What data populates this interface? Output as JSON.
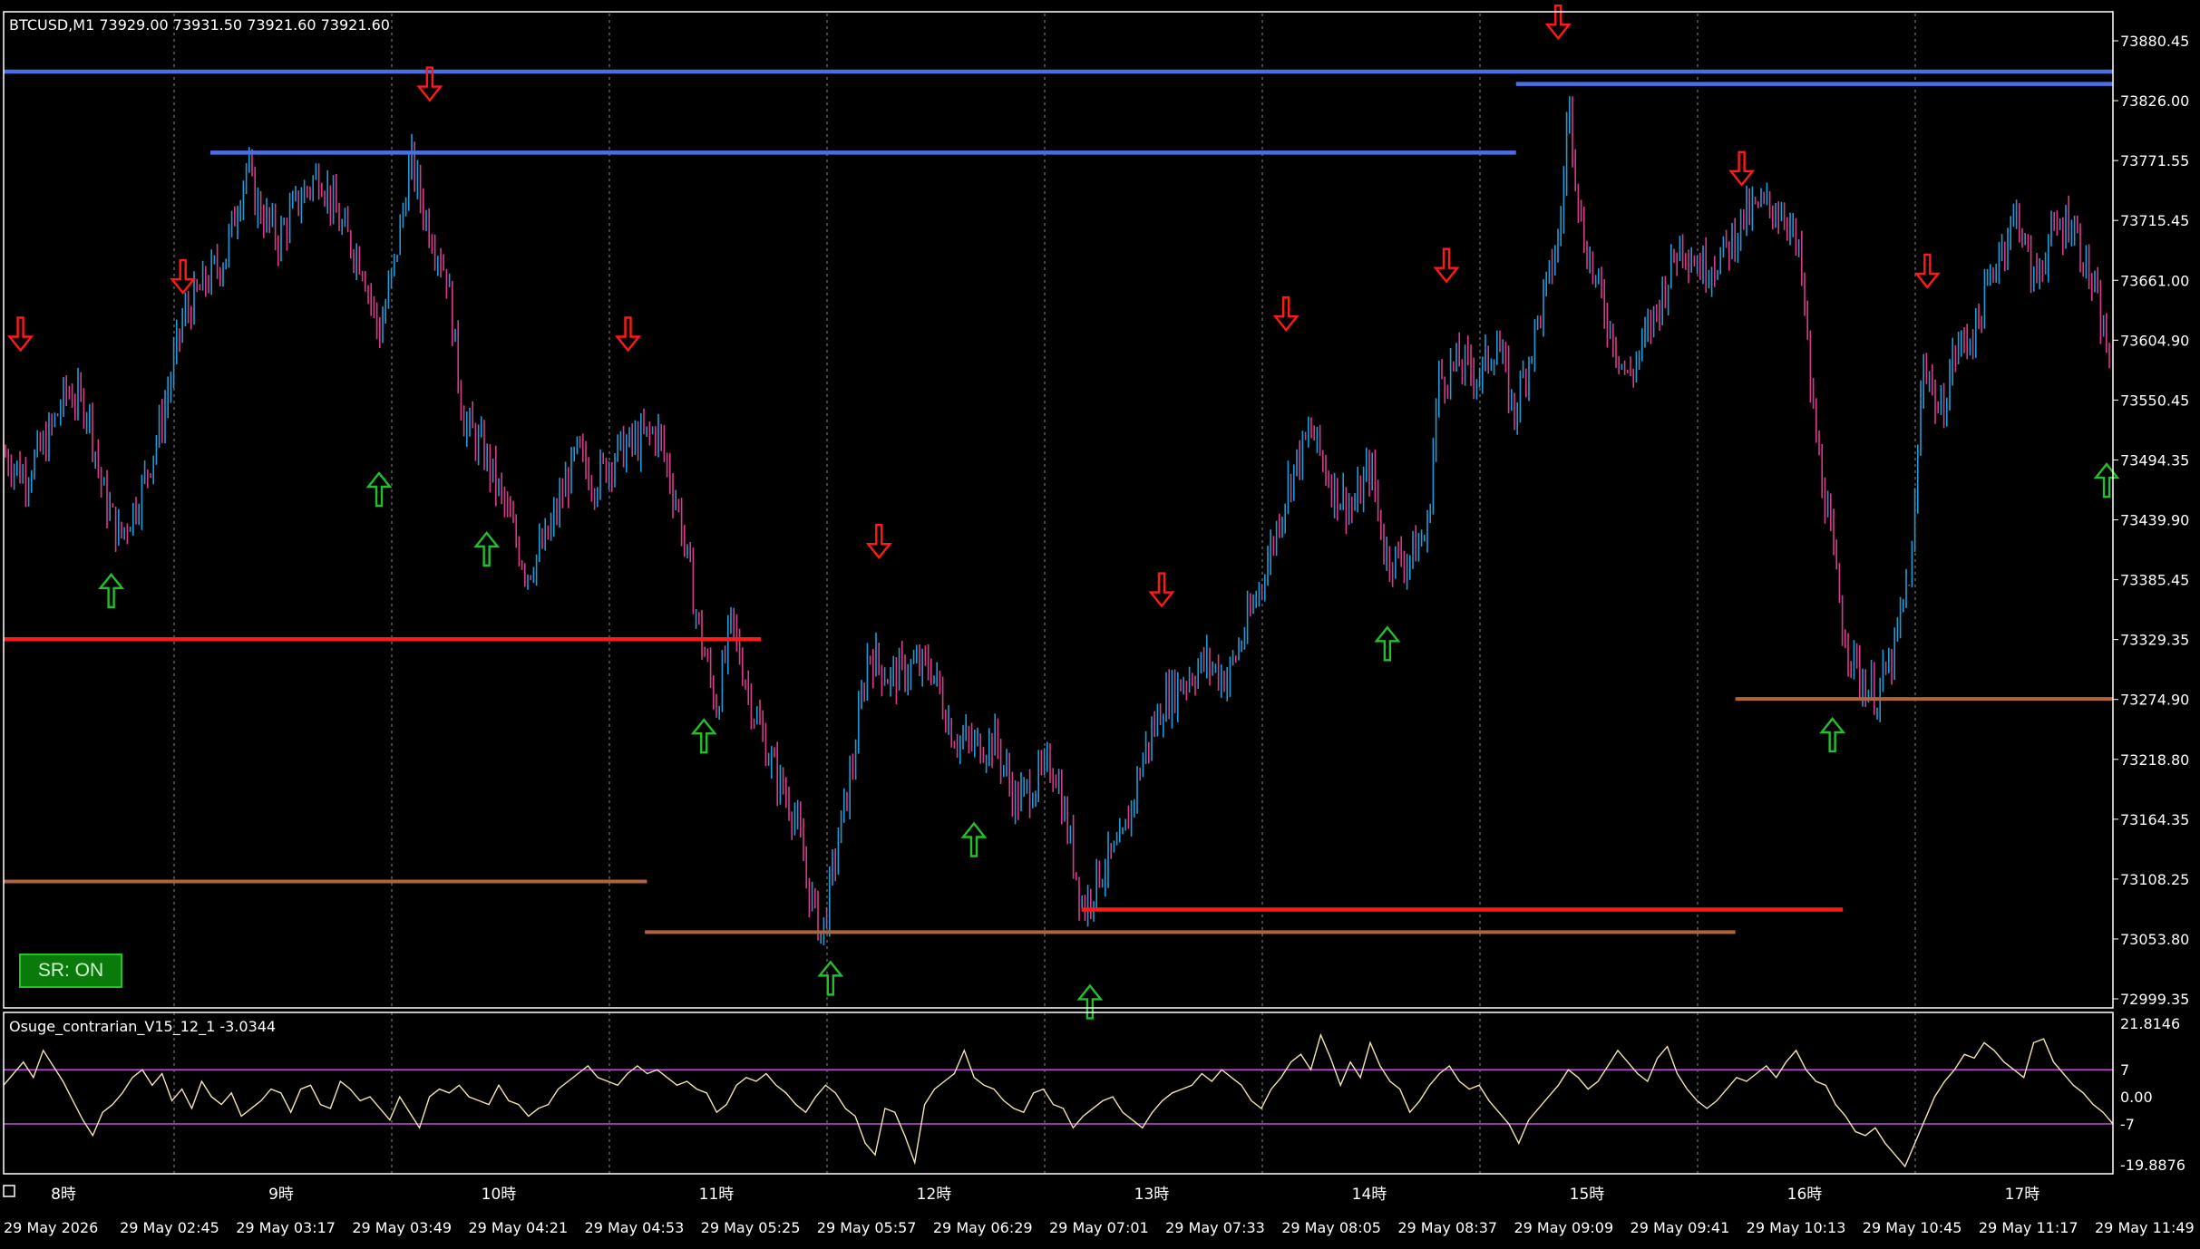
{
  "header": {
    "symbol_info": "BTCUSD,M1  73929.00 73931.50 73921.60 73921.60",
    "indicator_info": "Osuge_contrarian_V15_12_1 -3.0344"
  },
  "sr_button": {
    "label": "SR: ON"
  },
  "colors": {
    "background": "#000000",
    "bull_candle": "#1e9bd7",
    "bear_candle": "#d83a8c",
    "resistance_line": "#4a6fe3",
    "support_red": "#ff1a1a",
    "support_brown": "#b0643a",
    "signal_down": "#ff1a1a",
    "signal_up": "#22c02a",
    "oscillator": "#f3e3b0",
    "oscillator_levels": "#c24fd8",
    "grid": "#8a8a8a"
  },
  "chart_data": [
    {
      "type": "candlestick",
      "title": "BTCUSD,M1",
      "y_ticks": [
        "73880.45",
        "73826.00",
        "73771.55",
        "73715.45",
        "73661.00",
        "73604.90",
        "73550.45",
        "73494.35",
        "73439.90",
        "73385.45",
        "73329.35",
        "73274.90",
        "73218.80",
        "73164.35",
        "73108.25",
        "73053.80",
        "72999.35"
      ],
      "ylim": [
        72999.35,
        73880.45
      ],
      "x_ticks_hour": [
        "8時",
        "9時",
        "10時",
        "11時",
        "12時",
        "13時",
        "14時",
        "15時",
        "16時",
        "17時"
      ],
      "x_ticks_time": [
        "29 May 2026",
        "29 May 02:45",
        "29 May 03:17",
        "29 May 03:49",
        "29 May 04:21",
        "29 May 04:53",
        "29 May 05:25",
        "29 May 05:57",
        "29 May 06:29",
        "29 May 07:01",
        "29 May 07:33",
        "29 May 08:05",
        "29 May 08:37",
        "29 May 09:09",
        "29 May 09:41",
        "29 May 10:13",
        "29 May 10:45",
        "29 May 11:17",
        "29 May 11:49"
      ],
      "grid": "vertical dotted at hour marks",
      "price_path": [
        {
          "x": 0.0,
          "y": 73490
        },
        {
          "x": 0.01,
          "y": 73470
        },
        {
          "x": 0.02,
          "y": 73500
        },
        {
          "x": 0.03,
          "y": 73545
        },
        {
          "x": 0.04,
          "y": 73530
        },
        {
          "x": 0.047,
          "y": 73455
        },
        {
          "x": 0.055,
          "y": 73415
        },
        {
          "x": 0.065,
          "y": 73455
        },
        {
          "x": 0.075,
          "y": 73520
        },
        {
          "x": 0.085,
          "y": 73610
        },
        {
          "x": 0.095,
          "y": 73640
        },
        {
          "x": 0.105,
          "y": 73665
        },
        {
          "x": 0.115,
          "y": 73745
        },
        {
          "x": 0.12,
          "y": 73712
        },
        {
          "x": 0.13,
          "y": 73680
        },
        {
          "x": 0.14,
          "y": 73715
        },
        {
          "x": 0.15,
          "y": 73740
        },
        {
          "x": 0.16,
          "y": 73690
        },
        {
          "x": 0.17,
          "y": 73660
        },
        {
          "x": 0.178,
          "y": 73595
        },
        {
          "x": 0.185,
          "y": 73655
        },
        {
          "x": 0.193,
          "y": 73750
        },
        {
          "x": 0.2,
          "y": 73700
        },
        {
          "x": 0.21,
          "y": 73650
        },
        {
          "x": 0.218,
          "y": 73520
        },
        {
          "x": 0.228,
          "y": 73490
        },
        {
          "x": 0.238,
          "y": 73440
        },
        {
          "x": 0.248,
          "y": 73385
        },
        {
          "x": 0.258,
          "y": 73415
        },
        {
          "x": 0.265,
          "y": 73455
        },
        {
          "x": 0.272,
          "y": 73490
        },
        {
          "x": 0.28,
          "y": 73465
        },
        {
          "x": 0.29,
          "y": 73490
        },
        {
          "x": 0.3,
          "y": 73500
        },
        {
          "x": 0.31,
          "y": 73510
        },
        {
          "x": 0.32,
          "y": 73440
        },
        {
          "x": 0.33,
          "y": 73330
        },
        {
          "x": 0.338,
          "y": 73265
        },
        {
          "x": 0.345,
          "y": 73340
        },
        {
          "x": 0.355,
          "y": 73265
        },
        {
          "x": 0.365,
          "y": 73210
        },
        {
          "x": 0.375,
          "y": 73170
        },
        {
          "x": 0.382,
          "y": 73100
        },
        {
          "x": 0.388,
          "y": 73062
        },
        {
          "x": 0.395,
          "y": 73140
        },
        {
          "x": 0.403,
          "y": 73220
        },
        {
          "x": 0.41,
          "y": 73315
        },
        {
          "x": 0.42,
          "y": 73290
        },
        {
          "x": 0.43,
          "y": 73300
        },
        {
          "x": 0.44,
          "y": 73300
        },
        {
          "x": 0.45,
          "y": 73240
        },
        {
          "x": 0.46,
          "y": 73230
        },
        {
          "x": 0.47,
          "y": 73235
        },
        {
          "x": 0.48,
          "y": 73180
        },
        {
          "x": 0.49,
          "y": 73200
        },
        {
          "x": 0.498,
          "y": 73215
        },
        {
          "x": 0.505,
          "y": 73150
        },
        {
          "x": 0.512,
          "y": 73085
        },
        {
          "x": 0.52,
          "y": 73120
        },
        {
          "x": 0.53,
          "y": 73140
        },
        {
          "x": 0.54,
          "y": 73220
        },
        {
          "x": 0.55,
          "y": 73270
        },
        {
          "x": 0.56,
          "y": 73290
        },
        {
          "x": 0.57,
          "y": 73305
        },
        {
          "x": 0.58,
          "y": 73290
        },
        {
          "x": 0.59,
          "y": 73340
        },
        {
          "x": 0.6,
          "y": 73400
        },
        {
          "x": 0.61,
          "y": 73470
        },
        {
          "x": 0.62,
          "y": 73510
        },
        {
          "x": 0.63,
          "y": 73460
        },
        {
          "x": 0.64,
          "y": 73440
        },
        {
          "x": 0.648,
          "y": 73480
        },
        {
          "x": 0.655,
          "y": 73400
        },
        {
          "x": 0.665,
          "y": 73395
        },
        {
          "x": 0.675,
          "y": 73420
        },
        {
          "x": 0.68,
          "y": 73555
        },
        {
          "x": 0.69,
          "y": 73570
        },
        {
          "x": 0.7,
          "y": 73560
        },
        {
          "x": 0.708,
          "y": 73590
        },
        {
          "x": 0.716,
          "y": 73525
        },
        {
          "x": 0.725,
          "y": 73590
        },
        {
          "x": 0.732,
          "y": 73640
        },
        {
          "x": 0.738,
          "y": 73690
        },
        {
          "x": 0.742,
          "y": 73805
        },
        {
          "x": 0.748,
          "y": 73690
        },
        {
          "x": 0.755,
          "y": 73640
        },
        {
          "x": 0.762,
          "y": 73600
        },
        {
          "x": 0.77,
          "y": 73555
        },
        {
          "x": 0.778,
          "y": 73590
        },
        {
          "x": 0.786,
          "y": 73630
        },
        {
          "x": 0.795,
          "y": 73680
        },
        {
          "x": 0.805,
          "y": 73655
        },
        {
          "x": 0.815,
          "y": 73665
        },
        {
          "x": 0.825,
          "y": 73700
        },
        {
          "x": 0.835,
          "y": 73710
        },
        {
          "x": 0.845,
          "y": 73705
        },
        {
          "x": 0.852,
          "y": 73655
        },
        {
          "x": 0.858,
          "y": 73520
        },
        {
          "x": 0.865,
          "y": 73430
        },
        {
          "x": 0.872,
          "y": 73335
        },
        {
          "x": 0.88,
          "y": 73290
        },
        {
          "x": 0.888,
          "y": 73275
        },
        {
          "x": 0.896,
          "y": 73310
        },
        {
          "x": 0.905,
          "y": 73400
        },
        {
          "x": 0.91,
          "y": 73580
        },
        {
          "x": 0.918,
          "y": 73520
        },
        {
          "x": 0.925,
          "y": 73580
        },
        {
          "x": 0.935,
          "y": 73600
        },
        {
          "x": 0.945,
          "y": 73665
        },
        {
          "x": 0.955,
          "y": 73705
        },
        {
          "x": 0.962,
          "y": 73640
        },
        {
          "x": 0.97,
          "y": 73680
        },
        {
          "x": 0.98,
          "y": 73700
        },
        {
          "x": 0.99,
          "y": 73640
        },
        {
          "x": 1.0,
          "y": 73560
        }
      ],
      "resistance_lines": [
        {
          "x1": 0.0,
          "x2": 1.0,
          "y": 73829
        },
        {
          "x1": 0.717,
          "x2": 1.0,
          "y": 73818
        },
        {
          "x1": 0.098,
          "x2": 0.717,
          "y": 73757
        }
      ],
      "support_red_lines": [
        {
          "x1": 0.0,
          "x2": 0.359,
          "y": 73325
        },
        {
          "x1": 0.511,
          "x2": 0.872,
          "y": 73085
        }
      ],
      "support_brown_lines": [
        {
          "x1": 0.0,
          "x2": 0.305,
          "y": 73110
        },
        {
          "x1": 0.304,
          "x2": 0.821,
          "y": 73065
        },
        {
          "x1": 0.821,
          "x2": 1.0,
          "y": 73272
        }
      ],
      "down_arrows": [
        {
          "x": 0.008,
          "y": 73596
        },
        {
          "x": 0.085,
          "y": 73647
        },
        {
          "x": 0.202,
          "y": 73818
        },
        {
          "x": 0.296,
          "y": 73596
        },
        {
          "x": 0.415,
          "y": 73412
        },
        {
          "x": 0.549,
          "y": 73369
        },
        {
          "x": 0.608,
          "y": 73614
        },
        {
          "x": 0.684,
          "y": 73657
        },
        {
          "x": 0.737,
          "y": 73873
        },
        {
          "x": 0.824,
          "y": 73743
        },
        {
          "x": 0.912,
          "y": 73652
        }
      ],
      "up_arrows": [
        {
          "x": 0.051,
          "y": 73368
        },
        {
          "x": 0.178,
          "y": 73458
        },
        {
          "x": 0.229,
          "y": 73405
        },
        {
          "x": 0.332,
          "y": 73239
        },
        {
          "x": 0.392,
          "y": 73024
        },
        {
          "x": 0.46,
          "y": 73147
        },
        {
          "x": 0.515,
          "y": 73003
        },
        {
          "x": 0.656,
          "y": 73321
        },
        {
          "x": 0.867,
          "y": 73240
        },
        {
          "x": 0.997,
          "y": 73466
        }
      ]
    },
    {
      "type": "line",
      "title": "Osuge_contrarian_V15_12_1",
      "y_ticks": [
        "21.8146",
        "7",
        "0.00",
        "-7",
        "-19.8876"
      ],
      "ylim": [
        -19.8876,
        21.8146
      ],
      "levels": [
        7,
        -7
      ],
      "values": [
        3,
        6,
        9,
        5,
        12,
        8,
        4,
        -1,
        -6,
        -10,
        -4,
        -2,
        1,
        5,
        7,
        3,
        6,
        -1,
        2,
        -3,
        4,
        0,
        -2,
        1,
        -5,
        -3,
        -1,
        2,
        1,
        -4,
        2,
        3,
        -2,
        -3,
        4,
        2,
        -1,
        0,
        -3,
        -6,
        0,
        -4,
        -8,
        0,
        2,
        1,
        3,
        0,
        -1,
        -2,
        3,
        -1,
        -2,
        -5,
        -3,
        -2,
        2,
        4,
        6,
        8,
        5,
        4,
        3,
        6,
        8,
        6,
        7,
        5,
        3,
        4,
        2,
        1,
        -4,
        -2,
        3,
        5,
        4,
        6,
        3,
        1,
        -2,
        -4,
        0,
        3,
        1,
        -3,
        -5,
        -12,
        -15,
        -3,
        -4,
        -10,
        -17,
        -2,
        2,
        4,
        6,
        12,
        5,
        3,
        2,
        -1,
        -3,
        -4,
        1,
        2,
        -2,
        -3,
        -8,
        -5,
        -3,
        -1,
        0,
        -4,
        -6,
        -8,
        -4,
        -1,
        1,
        2,
        3,
        6,
        4,
        7,
        5,
        3,
        -1,
        -3,
        2,
        5,
        9,
        11,
        7,
        16,
        10,
        3,
        9,
        5,
        14,
        8,
        4,
        2,
        -4,
        -1,
        3,
        6,
        8,
        4,
        2,
        3,
        -1,
        -4,
        -7,
        -12,
        -6,
        -3,
        0,
        3,
        7,
        5,
        2,
        4,
        8,
        12,
        9,
        6,
        4,
        10,
        13,
        6,
        2,
        -1,
        -3,
        -1,
        2,
        5,
        4,
        6,
        8,
        5,
        9,
        12,
        7,
        4,
        3,
        -2,
        -5,
        -9,
        -10,
        -8,
        -12,
        -15,
        -18,
        -12,
        -6,
        0,
        4,
        7,
        11,
        10,
        14,
        12,
        9,
        7,
        5,
        14,
        15,
        9,
        6,
        3,
        1,
        -2,
        -4,
        -7
      ]
    }
  ]
}
